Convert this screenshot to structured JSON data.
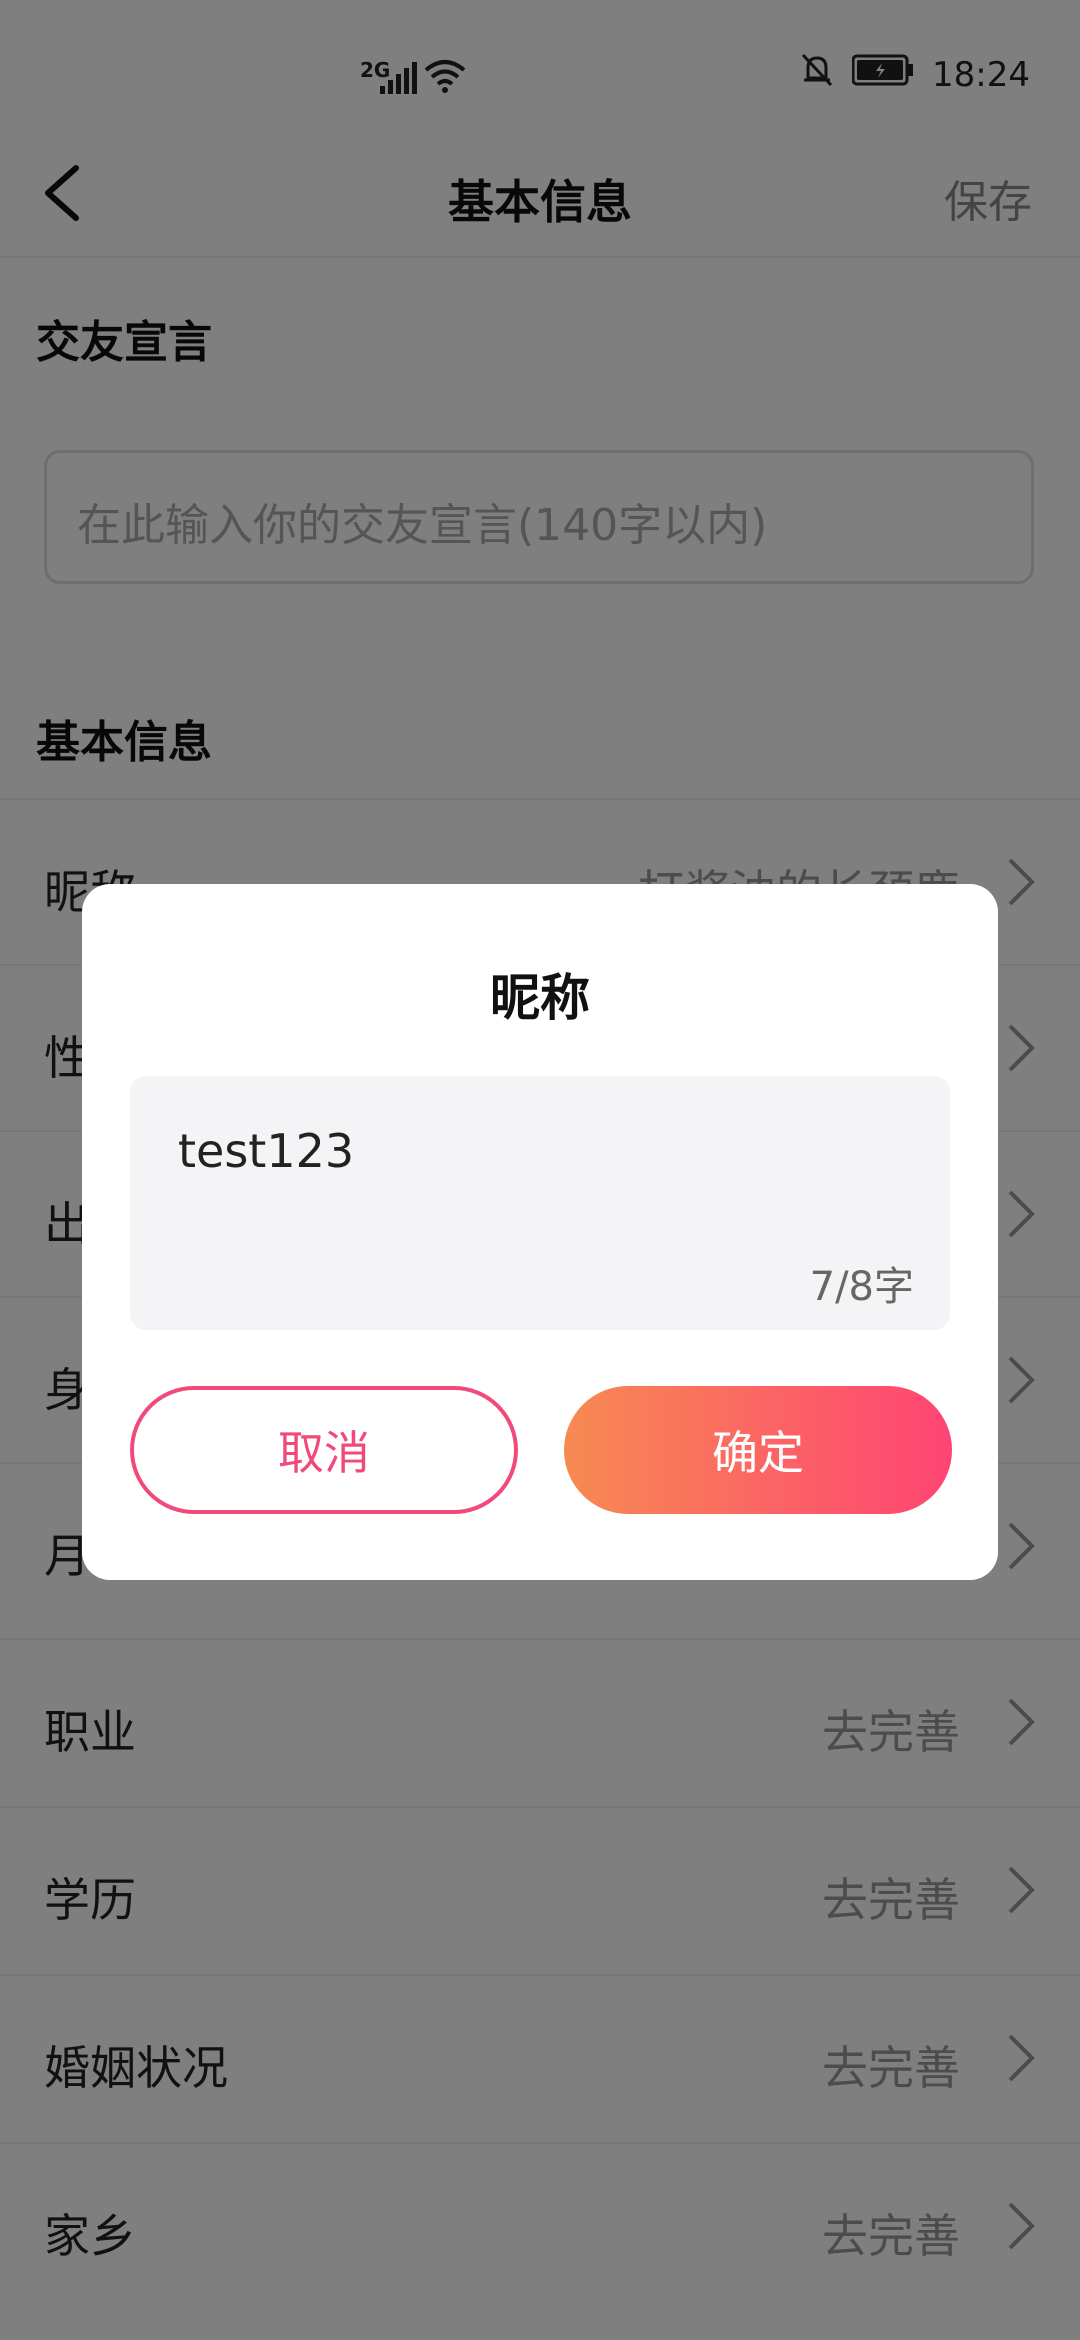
{
  "status": {
    "network": "2G",
    "time": "18:24"
  },
  "appbar": {
    "title": "基本信息",
    "save_label": "保存"
  },
  "sections": {
    "declaration_header": "交友宣言",
    "declaration_placeholder": "在此输入你的交友宣言(140字以内)",
    "basic_header": "基本信息"
  },
  "rows": [
    {
      "label": "昵称",
      "value": "打酱油的长颈鹿"
    },
    {
      "label": "性",
      "value": ""
    },
    {
      "label": "出",
      "value": ""
    },
    {
      "label": "身",
      "value": ""
    },
    {
      "label": "月",
      "value": ""
    },
    {
      "label": "职业",
      "value": "去完善"
    },
    {
      "label": "学历",
      "value": "去完善"
    },
    {
      "label": "婚姻状况",
      "value": "去完善"
    },
    {
      "label": "家乡",
      "value": "去完善"
    }
  ],
  "dialog": {
    "title": "昵称",
    "input_value": "test123",
    "char_count": "7/8字",
    "cancel_label": "取消",
    "confirm_label": "确定"
  },
  "colors": {
    "accent": "#f0497a",
    "gradient_start": "#f78a52",
    "gradient_end": "#ff4474"
  }
}
